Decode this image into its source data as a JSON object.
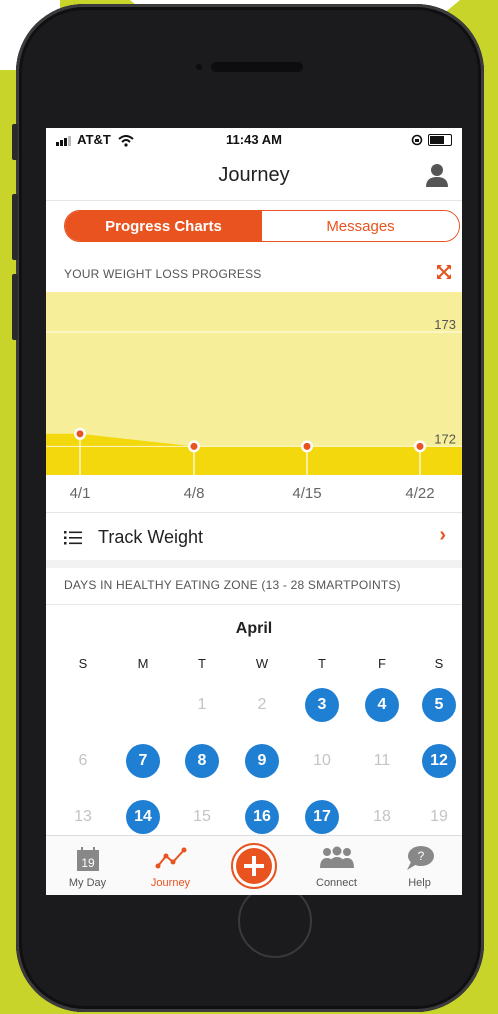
{
  "status_bar": {
    "carrier": "AT&T",
    "time": "11:43 AM"
  },
  "nav": {
    "title": "Journey",
    "profile_icon": "user-icon"
  },
  "segmented": {
    "active": "Progress Charts",
    "inactive": "Messages"
  },
  "weight_section": {
    "heading": "YOUR WEIGHT LOSS PROGRESS",
    "expand_icon": "expand-arrows-icon"
  },
  "chart_data": {
    "type": "area",
    "x": [
      "4/1",
      "4/8",
      "4/15",
      "4/22"
    ],
    "y_tick_labels": [
      "173",
      "172"
    ],
    "series": [
      {
        "values": [
          172.11,
          172.0,
          172.0,
          172.0
        ]
      }
    ],
    "ylim": [
      171.75,
      173.35
    ],
    "colors": {
      "fill_low": "#f2d80d",
      "fill_high": "#f7ee9a",
      "point": "#e8531f"
    }
  },
  "track": {
    "label": "Track Weight",
    "icon": "list-icon",
    "chevron": "›"
  },
  "healthy_section": {
    "heading": "DAYS IN HEALTHY EATING ZONE  (13 - 28 SMARTPOINTS)"
  },
  "calendar": {
    "month": "April",
    "weekdays": [
      "S",
      "M",
      "T",
      "W",
      "T",
      "F",
      "S"
    ],
    "rows": [
      [
        {
          "d": ""
        },
        {
          "d": ""
        },
        {
          "d": "1"
        },
        {
          "d": "2"
        },
        {
          "d": "3",
          "h": true
        },
        {
          "d": "4",
          "h": true
        },
        {
          "d": "5",
          "h": true
        }
      ],
      [
        {
          "d": "6"
        },
        {
          "d": "7",
          "h": true
        },
        {
          "d": "8",
          "h": true
        },
        {
          "d": "9",
          "h": true
        },
        {
          "d": "10"
        },
        {
          "d": "11"
        },
        {
          "d": "12",
          "h": true
        }
      ],
      [
        {
          "d": "13"
        },
        {
          "d": "14",
          "h": true
        },
        {
          "d": "15"
        },
        {
          "d": "16",
          "h": true
        },
        {
          "d": "17",
          "h": true
        },
        {
          "d": "18"
        },
        {
          "d": "19"
        }
      ]
    ],
    "highlight_color": "#1f7fd3"
  },
  "tabbar": {
    "tabs": [
      {
        "label": "My Day",
        "icon": "calendar-day-icon",
        "badge": "19"
      },
      {
        "label": "Journey",
        "icon": "journey-icon"
      },
      {
        "label": "",
        "icon": "add-plus-icon"
      },
      {
        "label": "Connect",
        "icon": "community-icon"
      },
      {
        "label": "Help",
        "icon": "help-bubble-icon",
        "badge": "?"
      }
    ]
  },
  "accent_color": "#e8531f"
}
